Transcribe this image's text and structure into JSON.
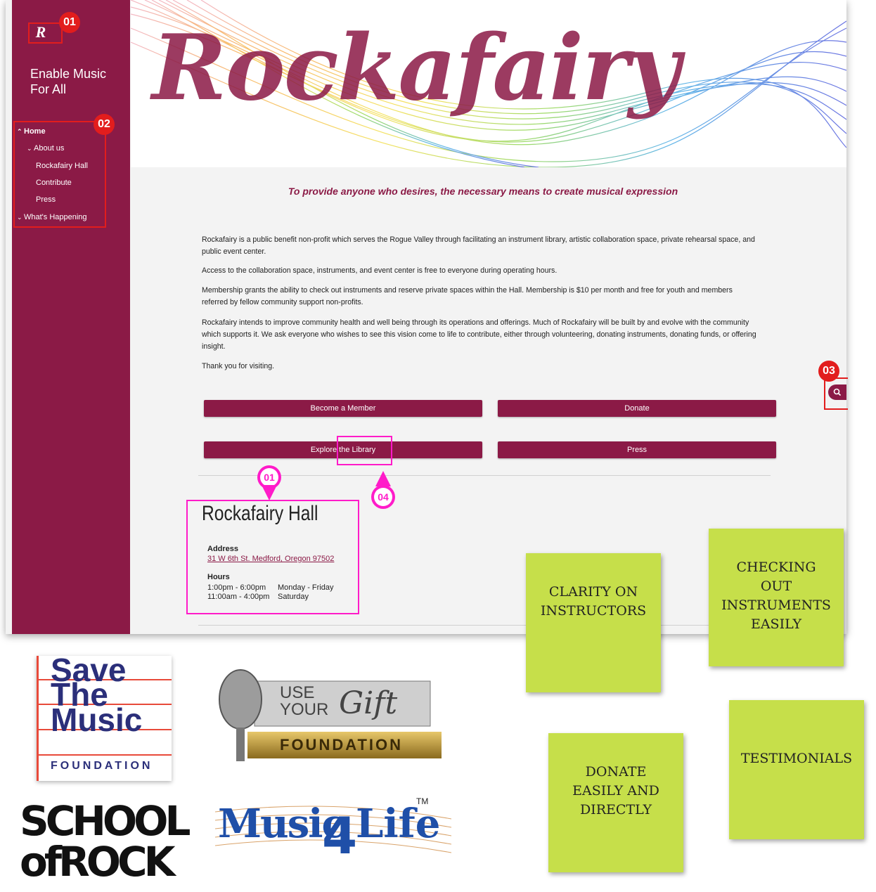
{
  "sidebar": {
    "logo_letter": "R",
    "tagline": "Enable Music For All",
    "nav": [
      {
        "label": "Home",
        "chevron": "^"
      },
      {
        "label": "About us",
        "chevron": "v"
      },
      {
        "label": "Rockafairy Hall"
      },
      {
        "label": "Contribute"
      },
      {
        "label": "Press"
      },
      {
        "label": "What's Happening",
        "chevron": "v"
      }
    ]
  },
  "hero": {
    "wordmark": "Rockafairy"
  },
  "main": {
    "mission": "To provide anyone who desires, the necessary means to create musical expression",
    "paragraphs": [
      "Rockafairy is a public benefit non-profit which serves the Rogue Valley through facilitating an instrument library, artistic collaboration space, private rehearsal space, and public event center.",
      "Access to the collaboration space, instruments, and event center is free to everyone during operating hours.",
      "Membership grants the ability to check out instruments and reserve private spaces within the Hall. Membership is $10 per month and free for youth and members referred by fellow community support non-profits.",
      "Rockafairy intends to improve community health and well being through its operations and offerings. Much of Rockafairy will be built by and evolve with the community which supports it. We ask everyone who wishes to see this vision come to life to contribute, either through volunteering, donating instruments, donating funds, or offering insight.",
      "Thank you for visiting."
    ],
    "buttons": {
      "member": "Become a Member",
      "donate": "Donate",
      "library": "Explore the Library",
      "press": "Press"
    },
    "hall": {
      "title": "Rockafairy Hall",
      "address_label": "Address",
      "address": "31 W 6th St. Medford, Oregon 97502",
      "hours_label": "Hours",
      "hours": [
        {
          "time": "1:00pm - 6:00pm",
          "days": "Monday - Friday"
        },
        {
          "time": "11:00am - 4:00pm",
          "days": "Saturday"
        }
      ]
    }
  },
  "annotations": {
    "red": [
      "01",
      "02",
      "03"
    ],
    "pink": [
      "01",
      "04"
    ]
  },
  "stickies": {
    "instructors": "CLARITY ON INSTRUCTORS",
    "checkout": "CHECKING OUT INSTRUMENTS EASILY",
    "donate": "DONATE EASILY AND DIRECTLY",
    "testimonials": "TESTIMONIALS"
  },
  "logos": {
    "save_the_music": {
      "line1": "Save",
      "line2": "The",
      "line3": "Music",
      "line4": "FOUNDATION"
    },
    "use_your_gift": {
      "line1": "USE",
      "line2": "YOUR",
      "script": "Gift",
      "line3": "FOUNDATION"
    },
    "school_of_rock": {
      "line1": "SCHOOL",
      "line2": "ofROCK"
    },
    "music4life": {
      "text": "Music",
      "four": "4",
      "life": "Life",
      "tm": "TM"
    }
  },
  "colors": {
    "brand": "#8b1a46",
    "annotation_red": "#e21d1d",
    "annotation_pink": "#ff1bc9",
    "sticky": "#c6df4a"
  }
}
